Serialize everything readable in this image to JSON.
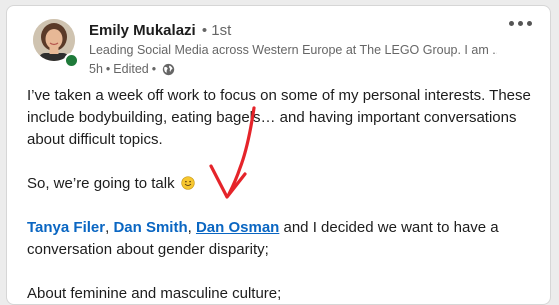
{
  "author": {
    "name": "Emily Mukalazi",
    "degree": "• 1st",
    "headline": "Leading Social Media across Western Europe at The LEGO Group. I am ...",
    "time": "5h",
    "separator": "•",
    "edited": "Edited",
    "separator2": "•",
    "status_color": "#1f7a3a"
  },
  "post": {
    "para1": "I’ve taken a week off work to focus on some of my personal interests. These include bodybuilding, eating bagels… and having important conversations about difficult topics.",
    "para2": "So, we’re going to talk",
    "mentions": [
      "Tanya Filer",
      "Dan Smith",
      "Dan Osman"
    ],
    "comma": ",",
    "para3_rest": " and I decided we want to have a conversation about gender disparity;",
    "para4": "About feminine and masculine culture;"
  },
  "icons": {
    "more": "more-options-icon",
    "visibility": "globe-icon",
    "emoji": "smiling-face-emoji",
    "annotation": "red-arrow"
  },
  "colors": {
    "link": "#0a66c2",
    "arrow": "#e5242a"
  }
}
